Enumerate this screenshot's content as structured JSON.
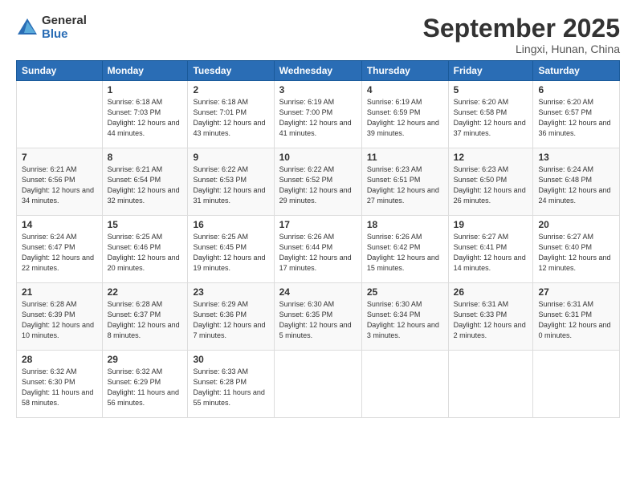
{
  "logo": {
    "general": "General",
    "blue": "Blue"
  },
  "header": {
    "month": "September 2025",
    "location": "Lingxi, Hunan, China"
  },
  "weekdays": [
    "Sunday",
    "Monday",
    "Tuesday",
    "Wednesday",
    "Thursday",
    "Friday",
    "Saturday"
  ],
  "weeks": [
    [
      {
        "day": "",
        "sunrise": "",
        "sunset": "",
        "daylight": ""
      },
      {
        "day": "1",
        "sunrise": "Sunrise: 6:18 AM",
        "sunset": "Sunset: 7:03 PM",
        "daylight": "Daylight: 12 hours and 44 minutes."
      },
      {
        "day": "2",
        "sunrise": "Sunrise: 6:18 AM",
        "sunset": "Sunset: 7:01 PM",
        "daylight": "Daylight: 12 hours and 43 minutes."
      },
      {
        "day": "3",
        "sunrise": "Sunrise: 6:19 AM",
        "sunset": "Sunset: 7:00 PM",
        "daylight": "Daylight: 12 hours and 41 minutes."
      },
      {
        "day": "4",
        "sunrise": "Sunrise: 6:19 AM",
        "sunset": "Sunset: 6:59 PM",
        "daylight": "Daylight: 12 hours and 39 minutes."
      },
      {
        "day": "5",
        "sunrise": "Sunrise: 6:20 AM",
        "sunset": "Sunset: 6:58 PM",
        "daylight": "Daylight: 12 hours and 37 minutes."
      },
      {
        "day": "6",
        "sunrise": "Sunrise: 6:20 AM",
        "sunset": "Sunset: 6:57 PM",
        "daylight": "Daylight: 12 hours and 36 minutes."
      }
    ],
    [
      {
        "day": "7",
        "sunrise": "Sunrise: 6:21 AM",
        "sunset": "Sunset: 6:56 PM",
        "daylight": "Daylight: 12 hours and 34 minutes."
      },
      {
        "day": "8",
        "sunrise": "Sunrise: 6:21 AM",
        "sunset": "Sunset: 6:54 PM",
        "daylight": "Daylight: 12 hours and 32 minutes."
      },
      {
        "day": "9",
        "sunrise": "Sunrise: 6:22 AM",
        "sunset": "Sunset: 6:53 PM",
        "daylight": "Daylight: 12 hours and 31 minutes."
      },
      {
        "day": "10",
        "sunrise": "Sunrise: 6:22 AM",
        "sunset": "Sunset: 6:52 PM",
        "daylight": "Daylight: 12 hours and 29 minutes."
      },
      {
        "day": "11",
        "sunrise": "Sunrise: 6:23 AM",
        "sunset": "Sunset: 6:51 PM",
        "daylight": "Daylight: 12 hours and 27 minutes."
      },
      {
        "day": "12",
        "sunrise": "Sunrise: 6:23 AM",
        "sunset": "Sunset: 6:50 PM",
        "daylight": "Daylight: 12 hours and 26 minutes."
      },
      {
        "day": "13",
        "sunrise": "Sunrise: 6:24 AM",
        "sunset": "Sunset: 6:48 PM",
        "daylight": "Daylight: 12 hours and 24 minutes."
      }
    ],
    [
      {
        "day": "14",
        "sunrise": "Sunrise: 6:24 AM",
        "sunset": "Sunset: 6:47 PM",
        "daylight": "Daylight: 12 hours and 22 minutes."
      },
      {
        "day": "15",
        "sunrise": "Sunrise: 6:25 AM",
        "sunset": "Sunset: 6:46 PM",
        "daylight": "Daylight: 12 hours and 20 minutes."
      },
      {
        "day": "16",
        "sunrise": "Sunrise: 6:25 AM",
        "sunset": "Sunset: 6:45 PM",
        "daylight": "Daylight: 12 hours and 19 minutes."
      },
      {
        "day": "17",
        "sunrise": "Sunrise: 6:26 AM",
        "sunset": "Sunset: 6:44 PM",
        "daylight": "Daylight: 12 hours and 17 minutes."
      },
      {
        "day": "18",
        "sunrise": "Sunrise: 6:26 AM",
        "sunset": "Sunset: 6:42 PM",
        "daylight": "Daylight: 12 hours and 15 minutes."
      },
      {
        "day": "19",
        "sunrise": "Sunrise: 6:27 AM",
        "sunset": "Sunset: 6:41 PM",
        "daylight": "Daylight: 12 hours and 14 minutes."
      },
      {
        "day": "20",
        "sunrise": "Sunrise: 6:27 AM",
        "sunset": "Sunset: 6:40 PM",
        "daylight": "Daylight: 12 hours and 12 minutes."
      }
    ],
    [
      {
        "day": "21",
        "sunrise": "Sunrise: 6:28 AM",
        "sunset": "Sunset: 6:39 PM",
        "daylight": "Daylight: 12 hours and 10 minutes."
      },
      {
        "day": "22",
        "sunrise": "Sunrise: 6:28 AM",
        "sunset": "Sunset: 6:37 PM",
        "daylight": "Daylight: 12 hours and 8 minutes."
      },
      {
        "day": "23",
        "sunrise": "Sunrise: 6:29 AM",
        "sunset": "Sunset: 6:36 PM",
        "daylight": "Daylight: 12 hours and 7 minutes."
      },
      {
        "day": "24",
        "sunrise": "Sunrise: 6:30 AM",
        "sunset": "Sunset: 6:35 PM",
        "daylight": "Daylight: 12 hours and 5 minutes."
      },
      {
        "day": "25",
        "sunrise": "Sunrise: 6:30 AM",
        "sunset": "Sunset: 6:34 PM",
        "daylight": "Daylight: 12 hours and 3 minutes."
      },
      {
        "day": "26",
        "sunrise": "Sunrise: 6:31 AM",
        "sunset": "Sunset: 6:33 PM",
        "daylight": "Daylight: 12 hours and 2 minutes."
      },
      {
        "day": "27",
        "sunrise": "Sunrise: 6:31 AM",
        "sunset": "Sunset: 6:31 PM",
        "daylight": "Daylight: 12 hours and 0 minutes."
      }
    ],
    [
      {
        "day": "28",
        "sunrise": "Sunrise: 6:32 AM",
        "sunset": "Sunset: 6:30 PM",
        "daylight": "Daylight: 11 hours and 58 minutes."
      },
      {
        "day": "29",
        "sunrise": "Sunrise: 6:32 AM",
        "sunset": "Sunset: 6:29 PM",
        "daylight": "Daylight: 11 hours and 56 minutes."
      },
      {
        "day": "30",
        "sunrise": "Sunrise: 6:33 AM",
        "sunset": "Sunset: 6:28 PM",
        "daylight": "Daylight: 11 hours and 55 minutes."
      },
      {
        "day": "",
        "sunrise": "",
        "sunset": "",
        "daylight": ""
      },
      {
        "day": "",
        "sunrise": "",
        "sunset": "",
        "daylight": ""
      },
      {
        "day": "",
        "sunrise": "",
        "sunset": "",
        "daylight": ""
      },
      {
        "day": "",
        "sunrise": "",
        "sunset": "",
        "daylight": ""
      }
    ]
  ]
}
